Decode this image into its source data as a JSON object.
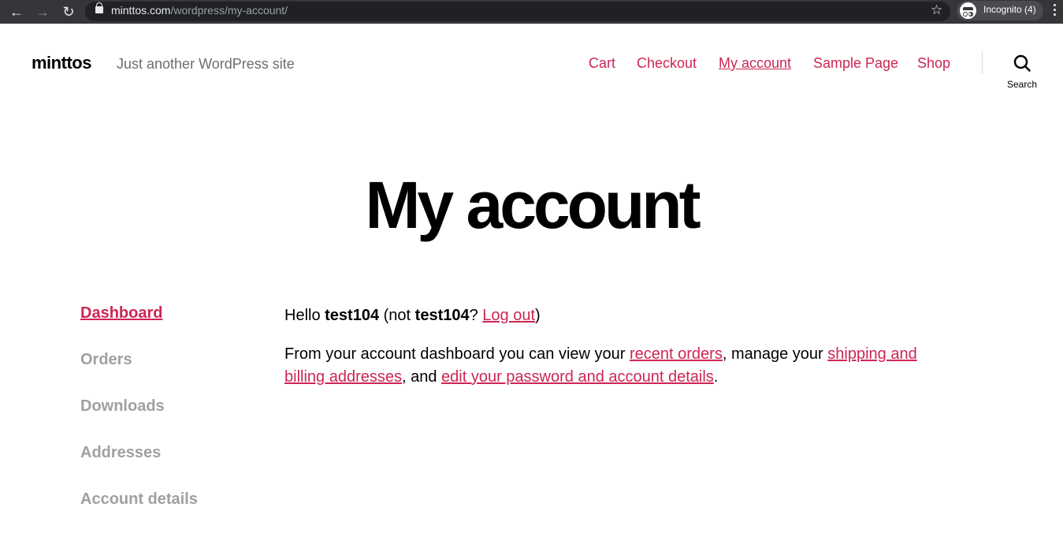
{
  "browser": {
    "url_host": "minttos.com",
    "url_path": "/wordpress/my-account/",
    "incognito_label": "Incognito (4)"
  },
  "site": {
    "title": "minttos",
    "tagline": "Just another WordPress site"
  },
  "nav": {
    "items": [
      "Cart",
      "Checkout",
      "My account",
      "Sample Page",
      "Shop"
    ],
    "current": "My account",
    "search_label": "Search"
  },
  "page": {
    "title": "My account"
  },
  "account_nav": {
    "items": [
      "Dashboard",
      "Orders",
      "Downloads",
      "Addresses",
      "Account details"
    ],
    "active": "Dashboard"
  },
  "content": {
    "hello_prefix": "Hello ",
    "username": "test104",
    "not_prefix": " (not ",
    "username_again": "test104",
    "question": "? ",
    "logout": "Log out",
    "close_paren": ")",
    "intro_1": "From your account dashboard you can view your ",
    "link_recent_orders": "recent orders",
    "intro_2": ", manage your ",
    "link_addresses": "shipping and billing addresses",
    "intro_3": ", and ",
    "link_account": "edit your password and account details",
    "intro_4": "."
  },
  "colors": {
    "accent": "#cd2653",
    "muted": "#a0a0a0",
    "chrome_bg": "#35363a"
  }
}
